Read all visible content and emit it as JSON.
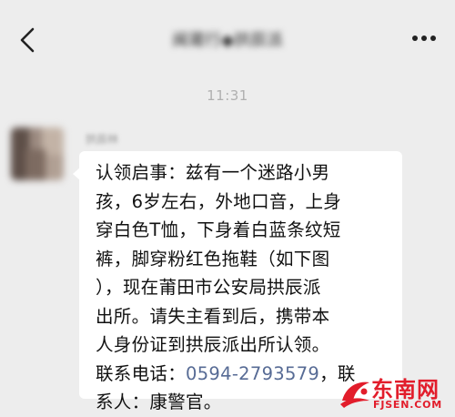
{
  "header": {
    "title": "闽莆行◆拱辰派",
    "back_icon": "chevron-left-icon",
    "more_icon": "more-dots-icon"
  },
  "time_divider": "11:31",
  "message": {
    "sender_name": "拱辰林",
    "lines": [
      "认领启事：兹有一个迷路小男",
      "孩，6岁左右，外地口音，上身",
      "穿白色T恤，下身着白蓝条纹短",
      "裤，脚穿粉红色拖鞋（如下图",
      "），现在莆田市公安局拱辰派",
      "出所。请失主看到后，携带本",
      "人身份证到拱辰派出所认领。"
    ],
    "last_line_prefix": "联系电话：",
    "phone": "0594-2793579",
    "last_line_suffix": "，联",
    "final_line": "系人：康警官。"
  },
  "watermark": {
    "name": "东南网",
    "domain": "FJSEN.COM",
    "color": "#e21d2b"
  }
}
